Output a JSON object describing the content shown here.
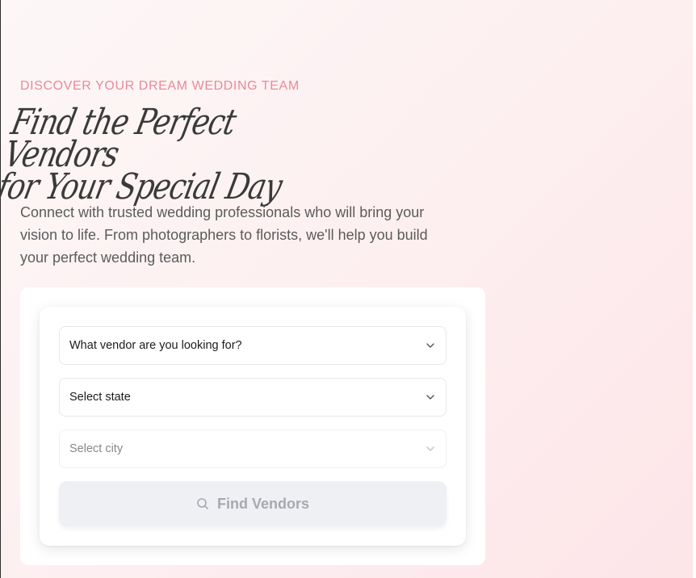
{
  "hero": {
    "eyebrow": "DISCOVER YOUR DREAM WEDDING TEAM",
    "headline_line1": "Find the Perfect Vendors",
    "headline_line2": "for Your Special Day",
    "description": "Connect with trusted wedding professionals who will bring your vision to life. From photographers to florists, we'll help you build your perfect wedding team."
  },
  "search": {
    "vendor_select": {
      "value": "What vendor are you looking for?",
      "icon": "chevron-down-icon"
    },
    "state_select": {
      "value": "Select state",
      "icon": "chevron-down-icon"
    },
    "city_select": {
      "value": "Select city",
      "icon": "chevron-down-icon",
      "disabled": true
    },
    "find_button": {
      "label": "Find Vendors",
      "icon": "search-icon",
      "disabled": true
    }
  },
  "colors": {
    "accent": "#e98a98",
    "headline": "#3a3a3a",
    "body_text": "#5b5b5b",
    "button_bg": "#eff0f3",
    "button_text": "#a6a9af"
  }
}
